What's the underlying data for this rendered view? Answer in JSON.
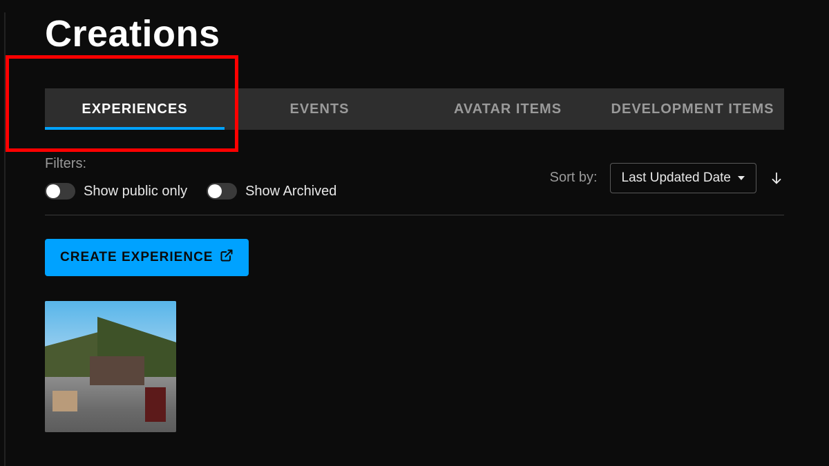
{
  "title": "Creations",
  "tabs": [
    {
      "label": "EXPERIENCES",
      "active": true
    },
    {
      "label": "EVENTS",
      "active": false
    },
    {
      "label": "AVATAR ITEMS",
      "active": false
    },
    {
      "label": "DEVELOPMENT ITEMS",
      "active": false
    }
  ],
  "filters": {
    "label": "Filters:",
    "toggles": [
      {
        "label": "Show public only",
        "on": false
      },
      {
        "label": "Show Archived",
        "on": false
      }
    ]
  },
  "sort": {
    "label": "Sort by:",
    "selected": "Last Updated Date",
    "direction": "desc"
  },
  "actions": {
    "create_label": "CREATE EXPERIENCE"
  }
}
